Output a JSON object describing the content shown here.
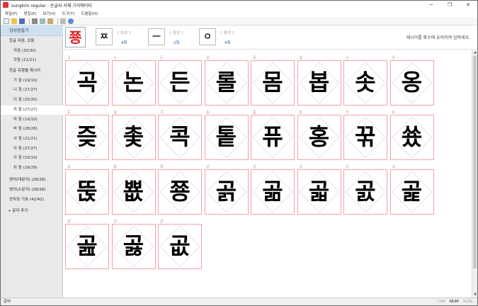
{
  "window": {
    "title": "sungkim regular - 손글씨 서체 크리에이터",
    "minimize_glyph": "─",
    "restore_glyph": "❐",
    "close_glyph": "✕"
  },
  "menu": [
    "파일(F)",
    "편집(E)",
    "보기(V)",
    "도구(T)",
    "도움말(H)"
  ],
  "sidebar": {
    "header": "감성꼼필기",
    "items": [
      {
        "label": "한글 자음, 모음",
        "type": "group"
      },
      {
        "label": "자음  (30/30)",
        "type": "sub"
      },
      {
        "label": "모음  (21/21)",
        "type": "sub"
      },
      {
        "label": "한글 유형별 제시어",
        "type": "group"
      },
      {
        "label": "가 형  (19/19)",
        "type": "sub"
      },
      {
        "label": "나 형  (27/27)",
        "type": "sub"
      },
      {
        "label": "다 형  (20/20)",
        "type": "sub"
      },
      {
        "label": "라 형  (27/27)",
        "type": "sub",
        "selected": true
      },
      {
        "label": "마 형  (19/19)",
        "type": "sub"
      },
      {
        "label": "바 형  (28/28)",
        "type": "sub"
      },
      {
        "label": "사 형  (21/21)",
        "type": "sub"
      },
      {
        "label": "아 형  (27/27)",
        "type": "sub"
      },
      {
        "label": "자 형  (19/19)",
        "type": "sub"
      },
      {
        "label": "차 형  (29/29)",
        "type": "sub"
      },
      {
        "label": "영어(대문자)  (26/26)",
        "type": "group"
      },
      {
        "label": "영어(소문자)  (26/26)",
        "type": "group"
      },
      {
        "label": "숫자와 기호  (42/42)",
        "type": "group"
      },
      {
        "label": "+ 문자 추가",
        "type": "add"
      }
    ]
  },
  "header": {
    "current_glyph": "쭁",
    "components": [
      {
        "glyph": "ㅉ",
        "label": "[ 초성 ]",
        "strokes": "4획"
      },
      {
        "glyph": "ㅡ",
        "label": "[ 중성 ]",
        "strokes": "2획"
      },
      {
        "glyph": "ㅇ",
        "label": "[ 종성 ]",
        "strokes": "4획"
      }
    ],
    "notice": "제시어를 확수에 유의하여 입력세요."
  },
  "glyphs": [
    {
      "label": "곡",
      "char": "곡"
    },
    {
      "label": "논",
      "char": "논"
    },
    {
      "label": "든",
      "char": "든"
    },
    {
      "label": "롤",
      "char": "롤"
    },
    {
      "label": "몸",
      "char": "몸"
    },
    {
      "label": "봅",
      "char": "봅"
    },
    {
      "label": "솟",
      "char": "솟"
    },
    {
      "label": "옹",
      "char": "옹"
    },
    {
      "label": "즞",
      "char": "즞"
    },
    {
      "label": "촟",
      "char": "촟"
    },
    {
      "label": "콕",
      "char": "콕"
    },
    {
      "label": "톹",
      "char": "톹"
    },
    {
      "label": "퓸",
      "char": "퓨"
    },
    {
      "label": "홍",
      "char": "홍"
    },
    {
      "label": "꾺",
      "char": "꾺"
    },
    {
      "label": "쑜",
      "char": "쑜"
    },
    {
      "label": "뚡",
      "char": "뚡"
    },
    {
      "label": "뿂",
      "char": "뿂"
    },
    {
      "label": "쭁",
      "char": "쭁"
    },
    {
      "label": "곩",
      "char": "곩"
    },
    {
      "label": "곪",
      "char": "곪"
    },
    {
      "label": "곫",
      "char": "곫"
    },
    {
      "label": "곬",
      "char": "곬"
    },
    {
      "label": "곭",
      "char": "곭"
    },
    {
      "label": "곮",
      "char": "곮"
    },
    {
      "label": "곯",
      "char": "곯"
    },
    {
      "label": "곲",
      "char": "곲"
    }
  ],
  "status": {
    "left": "준비",
    "indicators": [
      "CAP",
      "NUM",
      "SCRL"
    ]
  }
}
